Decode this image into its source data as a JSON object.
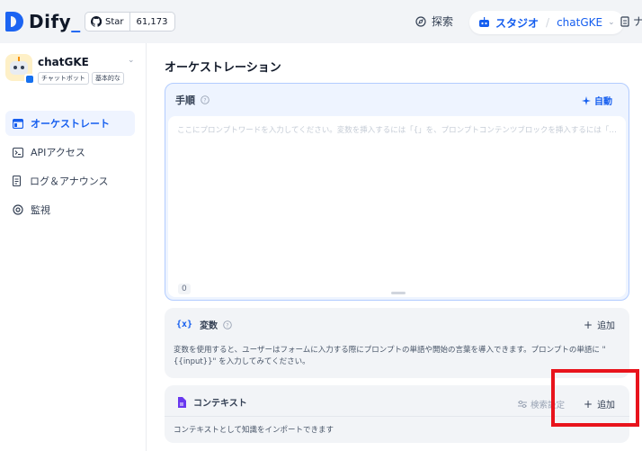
{
  "topbar": {
    "logo_text": "Dify",
    "logo_underscore": "_",
    "github_star_label": "Star",
    "github_star_count": "61,173",
    "explore_label": "探索",
    "studio_label": "スタジオ",
    "breadcrumb_separator": "/",
    "current_app": "chatGKE",
    "extra_label": "ナ"
  },
  "sidebar": {
    "app_name": "chatGKE",
    "tags": [
      "チャットボット",
      "基本的な"
    ],
    "items": [
      {
        "label": "オーケストレート",
        "icon": "orchestrate-icon",
        "active": true
      },
      {
        "label": "APIアクセス",
        "icon": "terminal-icon",
        "active": false
      },
      {
        "label": "ログ＆アナウンス",
        "icon": "log-icon",
        "active": false
      },
      {
        "label": "監視",
        "icon": "monitor-icon",
        "active": false
      }
    ]
  },
  "main": {
    "title": "オーケストレーション",
    "instructions": {
      "title": "手順",
      "auto_label": "自動",
      "placeholder": "ここにプロンプトワードを入力してください。変数を挿入するには「{」を、プロンプトコンテンツブロックを挿入するには「/」を入力...",
      "char_count": "0"
    },
    "variables": {
      "icon_text": "{x}",
      "title": "変数",
      "add_label": "追加",
      "description": "変数を使用すると、ユーザーはフォームに入力する際にプロンプトの単語や開始の言葉を導入できます。プロンプトの単語に \"{{input}}\" を入力してみてください。"
    },
    "context": {
      "title": "コンテキスト",
      "retrieval_label": "検索設定",
      "add_label": "追加",
      "description": "コンテキストとして知識をインポートできます"
    }
  },
  "colors": {
    "accent": "#155eef",
    "highlight": "#e8141c"
  }
}
